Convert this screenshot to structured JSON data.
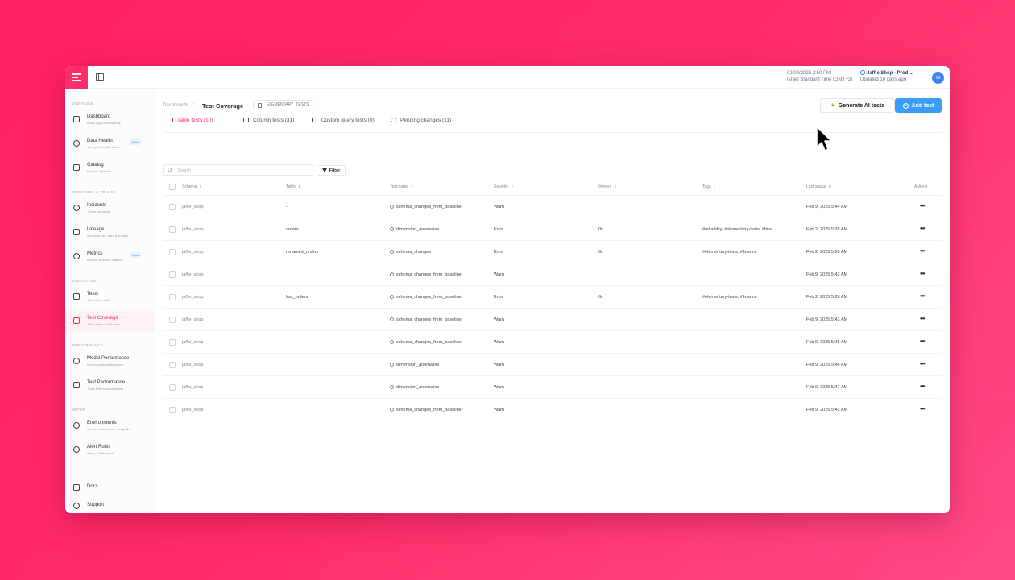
{
  "topbar": {
    "datetime": "02/09/2025 2:50 PM",
    "timezone": "Israel Standard Time (GMT+2)",
    "env_name": "Jaffle Shop - Prod",
    "env_chevron": "⌄",
    "env_updated": "Updated 10 days ago",
    "avatar_initials": "IG"
  },
  "sidebar": {
    "sections": [
      {
        "title": "OVERVIEW"
      },
      {
        "title": "RESPONSE & TRIAGE"
      },
      {
        "title": "VALIDATION"
      },
      {
        "title": "PERFORMANCE"
      },
      {
        "title": "SETUP"
      }
    ],
    "items": [
      {
        "label": "Dashboard",
        "desc": "Know high-level activity",
        "icon": "dashboard-icon"
      },
      {
        "label": "Data Health",
        "desc": "View your health score",
        "icon": "heart-pulse-icon",
        "badge": "New"
      },
      {
        "label": "Catalog",
        "desc": "Explore datasets",
        "icon": "catalog-icon"
      },
      {
        "label": "Incidents",
        "desc": "Triage incidents",
        "icon": "alert-circle-icon"
      },
      {
        "label": "Lineage",
        "desc": "Visualize your data & lineage",
        "icon": "lineage-icon"
      },
      {
        "label": "Metrics",
        "desc": "Explore & define metrics",
        "icon": "metrics-icon",
        "badge": "New"
      },
      {
        "label": "Tests",
        "desc": "View test results",
        "icon": "list-icon"
      },
      {
        "label": "Test Coverage",
        "desc": "Add, delete & edit tests",
        "icon": "plus-icon"
      },
      {
        "label": "Model Performance",
        "desc": "Detect underperformance",
        "icon": "gauge-icon"
      },
      {
        "label": "Test Performance",
        "desc": "Track test duration trends",
        "icon": "timer-icon"
      },
      {
        "label": "Environments",
        "desc": "Connect warehouse, setup & it",
        "icon": "database-icon"
      },
      {
        "label": "Alert Rules",
        "desc": "Setup & filter alerts",
        "icon": "bell-icon"
      },
      {
        "label": "Docs",
        "icon": "book-icon"
      },
      {
        "label": "Support",
        "icon": "help-icon"
      }
    ]
  },
  "header": {
    "breadcrumb_home": "Dashboards",
    "breadcrumb_sep": "/",
    "title": "Test Coverage",
    "schema_chip": "ELEMENTARY_TESTS",
    "generate_label": "Generate AI tests",
    "add_label": "Add test"
  },
  "tabs": [
    {
      "label": "Table tests (10)",
      "active": true
    },
    {
      "label": "Column tests (31)"
    },
    {
      "label": "Custom query tests (0)"
    },
    {
      "label": "Pending changes (11)"
    }
  ],
  "search": {
    "placeholder": "Search"
  },
  "filter_label": "Filter",
  "table": {
    "columns": [
      "Schema",
      "Table",
      "Test name",
      "Severity",
      "Owners",
      "Tags",
      "Last status",
      "Actions"
    ],
    "rows": [
      {
        "schema": "jaffle_shop",
        "table": "-",
        "test": "schema_changes_from_baseline",
        "severity": "Warn",
        "owners": "",
        "tags": "",
        "last_status": "Feb 9, 2025 5:44 AM"
      },
      {
        "schema": "jaffle_shop",
        "table": "orders",
        "test": "dimension_anomalies",
        "severity": "Error",
        "owners": "Or",
        "tags": "#reliability, #elementary-tests, #fina...",
        "last_status": "Feb 2, 2025 5:28 AM"
      },
      {
        "schema": "jaffle_shop",
        "table": "renamed_orders",
        "test": "schema_changes",
        "severity": "Error",
        "owners": "Or",
        "tags": "#elementary-tests, #finance",
        "last_status": "Feb 2, 2025 5:28 AM"
      },
      {
        "schema": "jaffle_shop",
        "table": "",
        "test": "schema_changes_from_baseline",
        "severity": "Warn",
        "owners": "",
        "tags": "",
        "last_status": "Feb 9, 2025 5:43 AM"
      },
      {
        "schema": "jaffle_shop",
        "table": "lost_orders",
        "test": "schema_changes_from_baseline",
        "severity": "Error",
        "owners": "Or",
        "tags": "#elementary-tests, #finance",
        "last_status": "Feb 2, 2025 5:28 AM"
      },
      {
        "schema": "jaffle_shop",
        "table": "",
        "test": "schema_changes_from_baseline",
        "severity": "Warn",
        "owners": "",
        "tags": "",
        "last_status": "Feb 9, 2025 5:43 AM"
      },
      {
        "schema": "jaffle_shop",
        "table": "-",
        "test": "schema_changes_from_baseline",
        "severity": "Warn",
        "owners": "",
        "tags": "",
        "last_status": "Feb 9, 2025 5:45 AM"
      },
      {
        "schema": "jaffle_shop",
        "table": "",
        "test": "dimension_anomalies",
        "severity": "Warn",
        "owners": "",
        "tags": "",
        "last_status": "Feb 9, 2025 5:46 AM"
      },
      {
        "schema": "jaffle_shop",
        "table": "-",
        "test": "dimension_anomalies",
        "severity": "Warn",
        "owners": "",
        "tags": "",
        "last_status": "Feb 9, 2025 5:47 AM"
      },
      {
        "schema": "jaffle_shop",
        "table": "",
        "test": "schema_changes_from_baseline",
        "severity": "Warn",
        "owners": "",
        "tags": "",
        "last_status": "Feb 9, 2025 5:43 AM"
      }
    ],
    "actions_glyph": "•••"
  },
  "colors": {
    "accent": "#ff2e6b",
    "primary_button": "#3b9df8",
    "background": "#ff2563"
  }
}
